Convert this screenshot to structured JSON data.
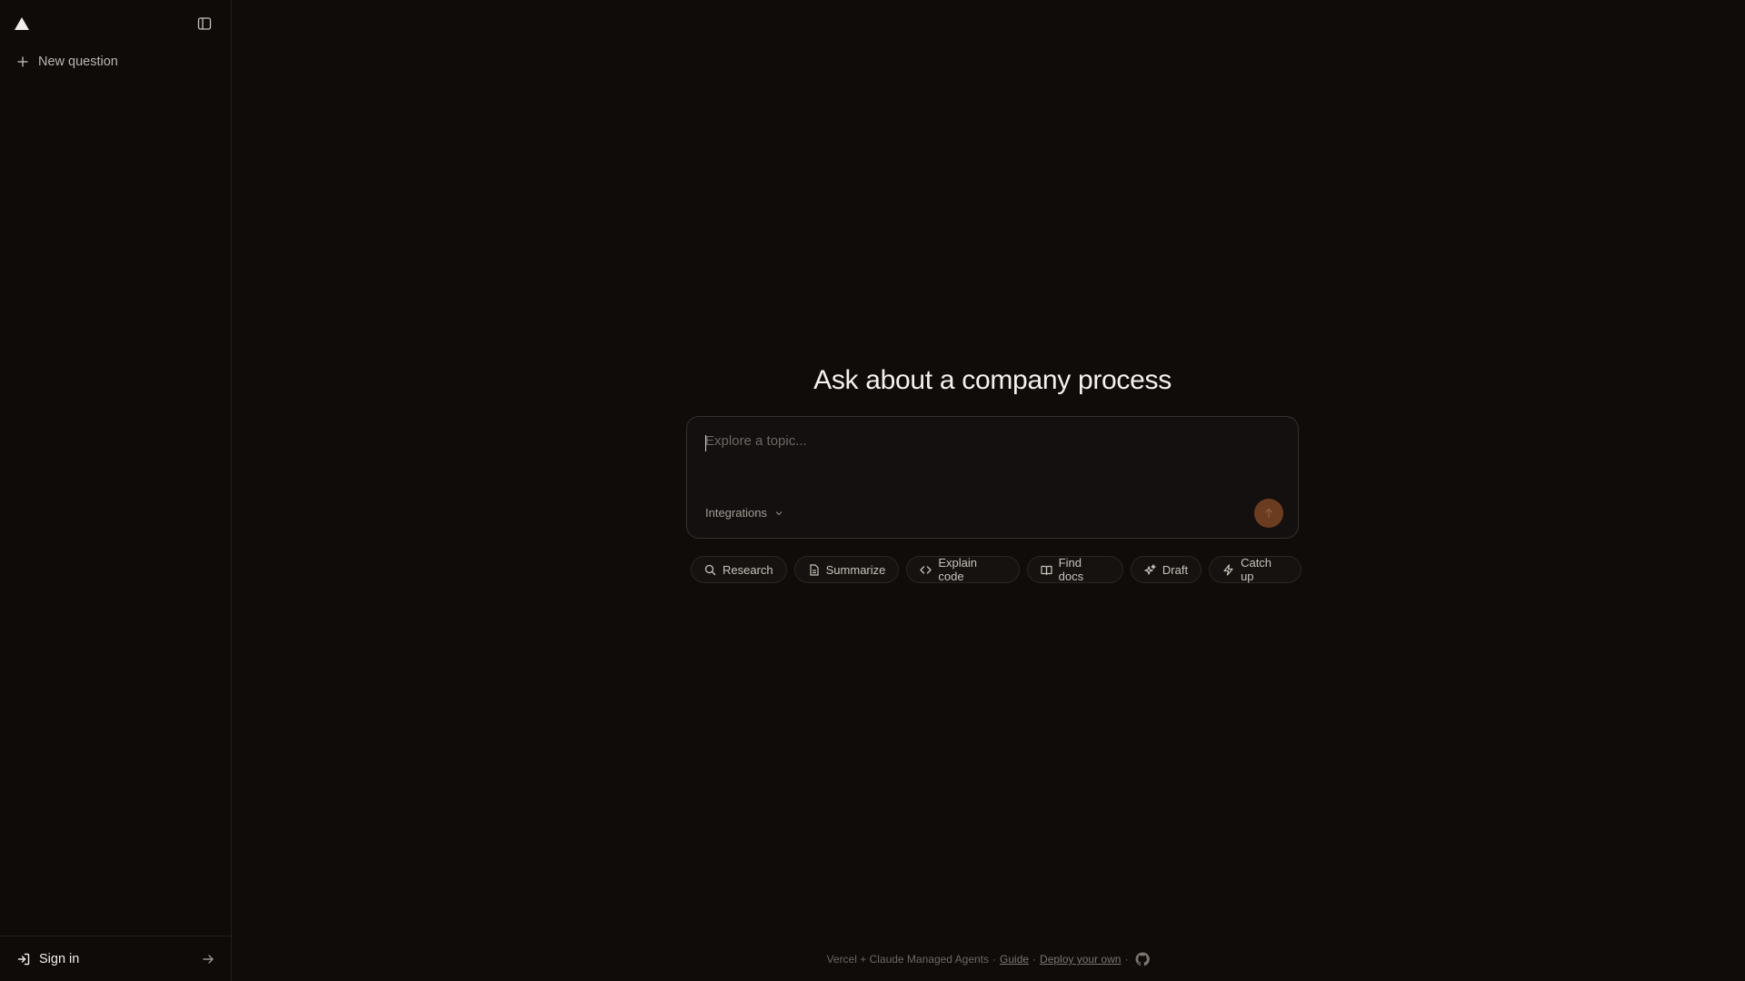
{
  "sidebar": {
    "logo_icon": "triangle-logo-icon",
    "toggle_icon": "sidebar-toggle-icon",
    "new_question_label": "New question",
    "sign_in_label": "Sign in"
  },
  "main": {
    "heading": "Ask about a company process",
    "composer": {
      "placeholder": "Explore a topic...",
      "value": "",
      "integrations_label": "Integrations",
      "send_icon": "arrow-up-icon"
    },
    "chips": [
      {
        "label": "Research",
        "icon": "search-icon"
      },
      {
        "label": "Summarize",
        "icon": "document-icon"
      },
      {
        "label": "Explain code",
        "icon": "code-icon"
      },
      {
        "label": "Find docs",
        "icon": "book-icon"
      },
      {
        "label": "Draft",
        "icon": "sparkles-icon"
      },
      {
        "label": "Catch up",
        "icon": "zap-icon"
      }
    ]
  },
  "footer": {
    "credit": "Vercel + Claude Managed Agents",
    "sep1": "·",
    "guide": "Guide",
    "sep2": "·",
    "deploy": "Deploy your own",
    "sep3": "·",
    "github_icon": "github-icon"
  },
  "colors": {
    "background": "#0f0c0a",
    "accent": "#6b3c1f"
  }
}
